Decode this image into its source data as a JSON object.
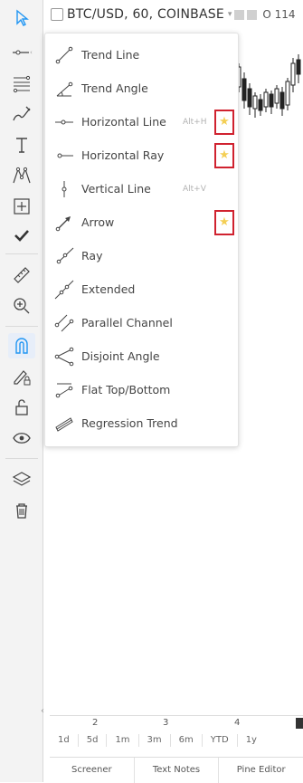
{
  "header": {
    "title": "BTC/USD, 60, COINBASE",
    "caret": "▾",
    "price": "O 114"
  },
  "left_toolbar": {
    "icons": [
      "cursor-arrow-icon",
      "horizontal-line-tool-icon",
      "fibonacci-icon",
      "brush-icon",
      "text-icon",
      "pattern-icon",
      "measure-box-icon",
      "check-icon",
      "ruler-icon",
      "zoom-in-icon",
      "magnet-icon",
      "lock-pencil-icon",
      "lock-icon",
      "eye-icon",
      "layers-icon",
      "trash-icon"
    ]
  },
  "menu": {
    "items": [
      {
        "label": "Trend Line",
        "shortcut": "",
        "favorite": false,
        "icon": "trend-line-icon"
      },
      {
        "label": "Trend Angle",
        "shortcut": "",
        "favorite": false,
        "icon": "trend-angle-icon"
      },
      {
        "label": "Horizontal Line",
        "shortcut": "Alt+H",
        "favorite": true,
        "icon": "horizontal-line-icon"
      },
      {
        "label": "Horizontal Ray",
        "shortcut": "",
        "favorite": true,
        "icon": "horizontal-ray-icon"
      },
      {
        "label": "Vertical Line",
        "shortcut": "Alt+V",
        "favorite": false,
        "icon": "vertical-line-icon"
      },
      {
        "label": "Arrow",
        "shortcut": "",
        "favorite": true,
        "icon": "arrow-icon"
      },
      {
        "label": "Ray",
        "shortcut": "",
        "favorite": false,
        "icon": "ray-icon"
      },
      {
        "label": "Extended",
        "shortcut": "",
        "favorite": false,
        "icon": "extended-line-icon"
      },
      {
        "label": "Parallel Channel",
        "shortcut": "",
        "favorite": false,
        "icon": "parallel-channel-icon"
      },
      {
        "label": "Disjoint Angle",
        "shortcut": "",
        "favorite": false,
        "icon": "disjoint-angle-icon"
      },
      {
        "label": "Flat Top/Bottom",
        "shortcut": "",
        "favorite": false,
        "icon": "flat-top-bottom-icon"
      },
      {
        "label": "Regression Trend",
        "shortcut": "",
        "favorite": false,
        "icon": "regression-trend-icon"
      }
    ]
  },
  "time_axis": {
    "labels": [
      "2",
      "3",
      "4"
    ]
  },
  "ranges": [
    "1d",
    "5d",
    "1m",
    "3m",
    "6m",
    "YTD",
    "1y"
  ],
  "bottom_tabs": [
    "Screener",
    "Text Notes",
    "Pine Editor"
  ],
  "colors": {
    "highlight_box": "#d0222f",
    "star": "#f4cf55",
    "accent": "#2196f3"
  }
}
